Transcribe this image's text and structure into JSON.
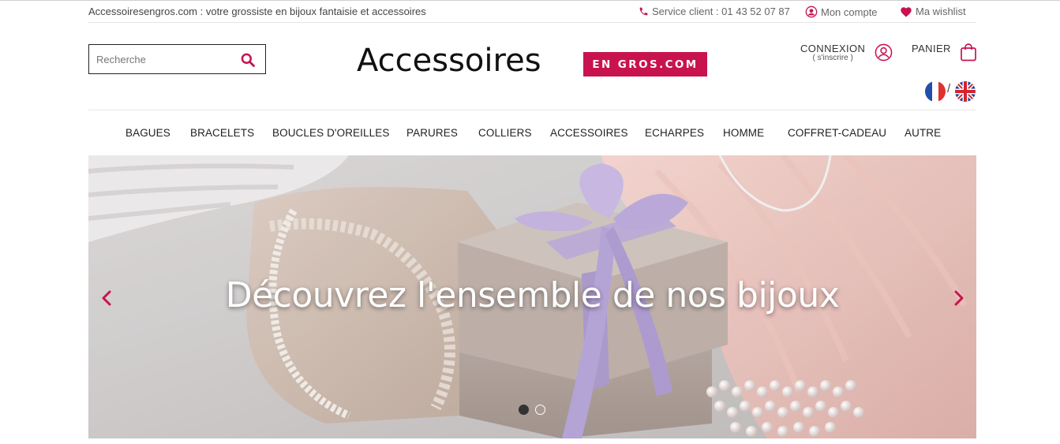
{
  "topbar": {
    "tagline": "Accessoiresengros.com : votre grossiste en bijoux fantaisie et accessoires",
    "service": "Service client : 01 43 52 07 87",
    "account": "Mon compte",
    "wishlist": "Ma wishlist"
  },
  "search": {
    "placeholder": "Recherche"
  },
  "logo": {
    "word": "Accessoires",
    "badge": "EN GROS.COM"
  },
  "header": {
    "connexion": "CONNEXION",
    "inscrire": "( s'inscrire )",
    "panier": "PANIER",
    "flag_separator": "/"
  },
  "nav": {
    "items": [
      "BAGUES",
      "BRACELETS",
      "BOUCLES D'OREILLES",
      "PARURES",
      "COLLIERS",
      "ACCESSOIRES",
      "ECHARPES",
      "HOMME",
      "COFFRET-CADEAU",
      "AUTRE"
    ]
  },
  "hero": {
    "headline": "Découvrez l'ensemble de nos bijoux",
    "active_slide": 1,
    "slide_count": 2
  },
  "colors": {
    "accent": "#c8134f",
    "text": "#222222"
  },
  "icons": [
    "search-icon",
    "phone-icon",
    "user-circle-icon",
    "heart-icon",
    "user-icon",
    "shopping-bag-icon",
    "french-flag-icon",
    "uk-flag-icon",
    "chevron-left-icon",
    "chevron-right-icon"
  ]
}
